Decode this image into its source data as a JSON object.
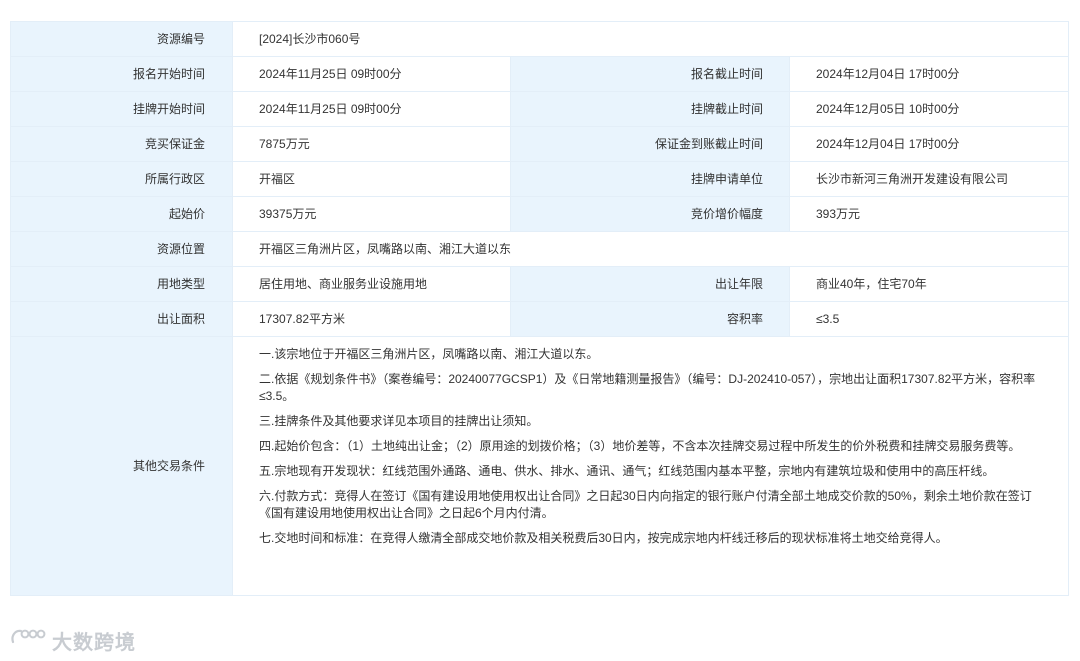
{
  "rows": {
    "r1": {
      "label": "资源编号",
      "value": "[2024]长沙市060号"
    },
    "r2": {
      "label": "报名开始时间",
      "value": "2024年11月25日 09时00分",
      "label2": "报名截止时间",
      "value2": "2024年12月04日 17时00分"
    },
    "r3": {
      "label": "挂牌开始时间",
      "value": "2024年11月25日 09时00分",
      "label2": "挂牌截止时间",
      "value2": "2024年12月05日 10时00分"
    },
    "r4": {
      "label": "竞买保证金",
      "value": "7875万元",
      "label2": "保证金到账截止时间",
      "value2": "2024年12月04日 17时00分"
    },
    "r5": {
      "label": "所属行政区",
      "value": "开福区",
      "label2": "挂牌申请单位",
      "value2": "长沙市新河三角洲开发建设有限公司"
    },
    "r6": {
      "label": "起始价",
      "value": "39375万元",
      "label2": "竞价增价幅度",
      "value2": "393万元"
    },
    "r7": {
      "label": "资源位置",
      "value": "开福区三角洲片区，凤嘴路以南、湘江大道以东"
    },
    "r8": {
      "label": "用地类型",
      "value": "居住用地、商业服务业设施用地",
      "label2": "出让年限",
      "value2": "商业40年，住宅70年"
    },
    "r9": {
      "label": "出让面积",
      "value": "17307.82平方米",
      "label2": "容积率",
      "value2": "≤3.5"
    }
  },
  "other": {
    "label": "其他交易条件",
    "paragraphs": [
      "一.该宗地位于开福区三角洲片区，凤嘴路以南、湘江大道以东。",
      "二.依据《规划条件书》（案卷编号：20240077GCSP1）及《日常地籍测量报告》（编号：DJ-202410-057），宗地出让面积17307.82平方米，容积率≤3.5。",
      "三.挂牌条件及其他要求详见本项目的挂牌出让须知。",
      "四.起始价包含：（1）土地纯出让金；（2）原用途的划拨价格；（3）地价差等，不含本次挂牌交易过程中所发生的价外税费和挂牌交易服务费等。",
      "五.宗地现有开发现状：红线范围外通路、通电、供水、排水、通讯、通气；红线范围内基本平整，宗地内有建筑垃圾和使用中的高压杆线。",
      "六.付款方式：竞得人在签订《国有建设用地使用权出让合同》之日起30日内向指定的银行账户付清全部土地成交价款的50%，剩余土地价款在签订《国有建设用地使用权出让合同》之日起6个月内付清。",
      "七.交地时间和标准：在竞得人缴清全部成交地价款及相关税费后30日内，按完成宗地内杆线迁移后的现状标准将土地交给竞得人。"
    ]
  },
  "watermark": {
    "text": "大数跨境",
    "icon": "logo-mark-icon"
  }
}
